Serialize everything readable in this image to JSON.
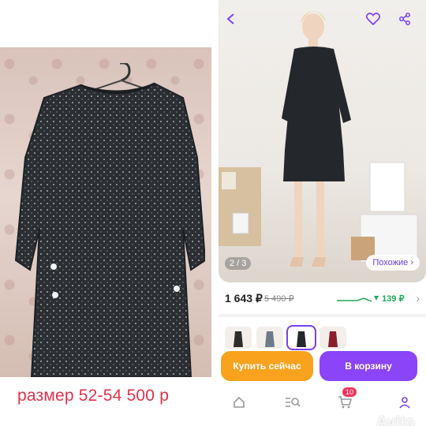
{
  "left_panel": {
    "caption": "размер 52-54 500 р"
  },
  "app": {
    "photo": {
      "counter": "2 / 3",
      "similar_label": "Похожие ›"
    },
    "price": {
      "current": "1 643 ₽",
      "old": "5 490 ₽",
      "cashback": "139 ₽"
    },
    "buttons": {
      "buy_now": "Купить сейчас",
      "add_to_cart": "В корзину"
    },
    "nav": {
      "cart_count": "10"
    },
    "watermark": "Avito",
    "colors": {
      "accent_purple": "#8b44f7",
      "buy_orange": "#f8a21d",
      "cashback_green": "#22a65a",
      "caption_red": "#e0324b"
    },
    "icons": [
      "back-icon",
      "heart-icon",
      "share-icon",
      "home-icon",
      "catalog-search-icon",
      "cart-icon",
      "profile-icon"
    ]
  }
}
